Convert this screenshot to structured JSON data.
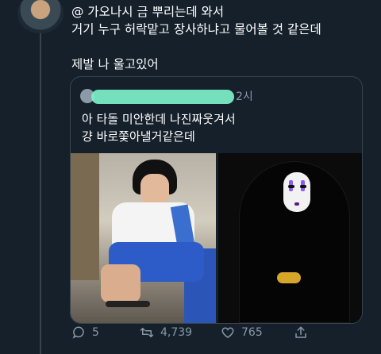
{
  "tweet": {
    "lines": [
      "@ 가오나시 금 뿌리는데 와서",
      "거기 누구 허락맡고 장사하냐고 물어볼 것 같은데",
      "제발 나 울고있어"
    ]
  },
  "quote": {
    "time": "2시",
    "lines": [
      "아 타돌 미안한데 나진짜웃겨서",
      "걍 바로쫓아낼거같은데"
    ]
  },
  "actions": {
    "reply_count": "5",
    "retweet_count": "4,739",
    "like_count": "765"
  },
  "icons": {
    "reply": "reply-icon",
    "retweet": "retweet-icon",
    "like": "heart-icon",
    "share": "share-icon"
  },
  "colors": {
    "background": "#15202b",
    "muted_text": "#8899a6",
    "border": "#38444d",
    "redaction": "#7ff0c8"
  }
}
